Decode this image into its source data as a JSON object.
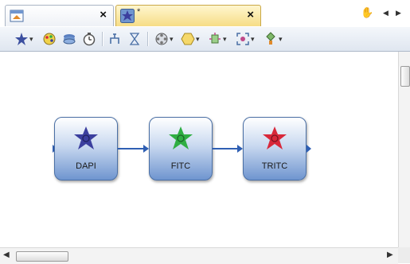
{
  "tabs": [
    {
      "icon": "experiment-document-icon",
      "modified": "",
      "close": "×"
    },
    {
      "icon": "star-fluorescence-icon",
      "modified": "*",
      "close": "×"
    }
  ],
  "strip_controls": {
    "pan": "✋",
    "prev": "◀",
    "next": "▶"
  },
  "toolbar": {
    "items": [
      "star-channel-icon",
      "color-palette-icon",
      "layers-stack-icon",
      "timer-icon",
      "z-stack-icon",
      "hourglass-icon",
      "filter-wheel-icon",
      "hexagon-shape-icon",
      "light-source-icon",
      "camera-focus-icon",
      "objective-icon"
    ],
    "dropdown_glyph": "▾"
  },
  "workflow": {
    "nodes": [
      {
        "label": "DAPI",
        "color": "#3b3f9e"
      },
      {
        "label": "FITC",
        "color": "#2fae43"
      },
      {
        "label": "TRITC",
        "color": "#d8283a"
      }
    ],
    "connector_color": "#2f5fb3"
  },
  "scrollbars": {
    "left_arrow": "◀",
    "right_arrow": "▶"
  }
}
